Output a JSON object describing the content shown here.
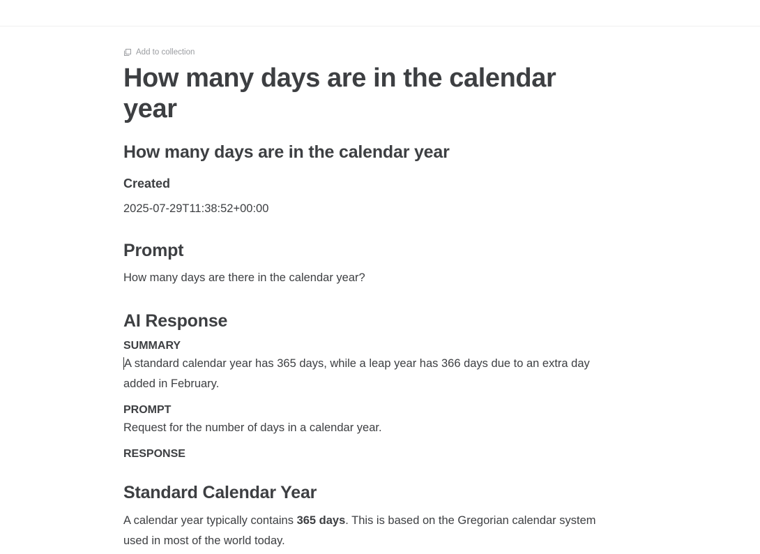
{
  "collection": {
    "label": "Add to collection",
    "icon": "copy-icon"
  },
  "title": "How many days are in the calendar year",
  "subtitle": "How many days are in the calendar year",
  "created": {
    "label": "Created",
    "value": "2025-07-29T11:38:52+00:00"
  },
  "prompt": {
    "heading": "Prompt",
    "text": "How many days are there in the calendar year?"
  },
  "ai": {
    "heading": "AI Response",
    "summary_label": "SUMMARY",
    "summary_first": "A",
    "summary_rest": " standard calendar year has 365 days, while a leap year has 366 days due to an extra day added in February.",
    "prompt_label": "PROMPT",
    "prompt_text": "Request for the number of days in a calendar year.",
    "response_label": "RESPONSE"
  },
  "standard": {
    "heading": "Standard Calendar Year",
    "text_before": "A calendar year typically contains ",
    "text_bold": "365 days",
    "text_after": ". This is based on the Gregorian calendar system used in most of the world today."
  }
}
